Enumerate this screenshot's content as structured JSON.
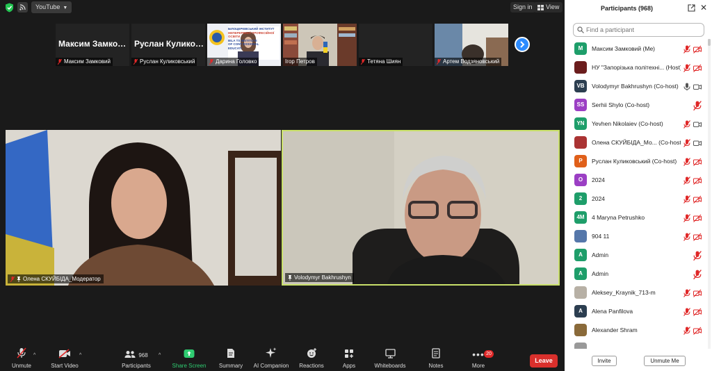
{
  "topbar": {
    "app_label": "YouTube",
    "signin_label": "Sign in",
    "view_label": "View"
  },
  "thumbnails": [
    {
      "name": "Максим Замковий",
      "display": "Максим Замко…",
      "type": "text"
    },
    {
      "name": "Руслан Куликовський",
      "display": "Руслан Кулико…",
      "type": "text"
    },
    {
      "name": "Дарина Головко",
      "type": "video",
      "banner": [
        "БІЛОЦЕРКІВСЬКИЙ ІНСТИТУТ",
        "НЕПЕРЕРВНОЇ ПРОФЕСІЙНОЇ ОСВІТИ",
        "BILA TS INSTITUTE",
        "OF CONT ESSIONAL",
        "EDUCATI"
      ]
    },
    {
      "name": "Ігор Петров",
      "type": "video"
    },
    {
      "name": "Тетяна Шиян",
      "type": "empty"
    },
    {
      "name": "Артем Водзяновський",
      "type": "video"
    }
  ],
  "main_videos": [
    {
      "name": "Олена СКУЙБІДА_Модератор"
    },
    {
      "name": "Volodymyr Bakhrushyn"
    }
  ],
  "toolbar": {
    "unmute": "Unmute",
    "start_video": "Start Video",
    "participants": "Participants",
    "participants_count": "968",
    "share_screen": "Share Screen",
    "summary": "Summary",
    "ai_companion": "AI Companion",
    "reactions": "Reactions",
    "apps": "Apps",
    "whiteboards": "Whiteboards",
    "notes": "Notes",
    "more": "More",
    "more_badge": "20",
    "leave": "Leave"
  },
  "panel": {
    "title": "Participants (968)",
    "search_placeholder": "Find a participant",
    "invite": "Invite",
    "unmute_me": "Unmute Me",
    "participants": [
      {
        "initials": "M",
        "name": "Максим Замковий (Me)",
        "color": "#1e9e6a",
        "mic": "muted",
        "cam": "off"
      },
      {
        "initials": "",
        "name": "НУ \"Запорізька політехні... (Host)",
        "color": "#6b1d1d",
        "mic": "muted",
        "cam": "off"
      },
      {
        "initials": "VB",
        "name": "Volodymyr Bakhrushyn (Co-host)",
        "color": "#2c3e50",
        "mic": "on",
        "cam": "on"
      },
      {
        "initials": "SS",
        "name": "Serhii Shylo (Co-host)",
        "color": "#9b3fc4",
        "mic": "none",
        "cam": "muted"
      },
      {
        "initials": "YN",
        "name": "Yevhen Nikolaiev (Co-host)",
        "color": "#1e9e6a",
        "mic": "muted",
        "cam": "on"
      },
      {
        "initials": "",
        "name": "Олена СКУЙБІДА_Мо... (Co-host)",
        "color": "#a33",
        "mic": "muted",
        "cam": "on"
      },
      {
        "initials": "P",
        "name": "Руслан Куликовський (Co-host)",
        "color": "#e0601a",
        "mic": "muted",
        "cam": "off"
      },
      {
        "initials": "О",
        "name": "2024",
        "color": "#9b3fc4",
        "mic": "muted",
        "cam": "off"
      },
      {
        "initials": "2",
        "name": "2024",
        "color": "#1e9e6a",
        "mic": "muted",
        "cam": "off"
      },
      {
        "initials": "4M",
        "name": "4 Maryna Petrushko",
        "color": "#1e9e6a",
        "mic": "muted",
        "cam": "off"
      },
      {
        "initials": "",
        "name": "904 11",
        "color": "#5577aa",
        "mic": "muted",
        "cam": "off"
      },
      {
        "initials": "A",
        "name": "Admin",
        "color": "#1e9e6a",
        "mic": "none",
        "cam": "muted"
      },
      {
        "initials": "A",
        "name": "Admin",
        "color": "#1e9e6a",
        "mic": "none",
        "cam": "muted"
      },
      {
        "initials": "",
        "name": "Aleksey_Kraynik_713-m",
        "color": "#b7b0a5",
        "mic": "muted",
        "cam": "off"
      },
      {
        "initials": "A",
        "name": "Alena Panfilova",
        "color": "#2c3e50",
        "mic": "muted",
        "cam": "off"
      },
      {
        "initials": "",
        "name": "Alexander Shram",
        "color": "#8a6a3a",
        "mic": "muted",
        "cam": "off"
      },
      {
        "initials": "",
        "name": "",
        "color": "#999",
        "mic": "none",
        "cam": "none"
      }
    ]
  },
  "colors": {
    "accent_blue": "#2d8cff",
    "muted_red": "#e02828",
    "share_green": "#2fcc71",
    "active_speaker": "#c9e06a",
    "leave_red": "#d9302c"
  }
}
